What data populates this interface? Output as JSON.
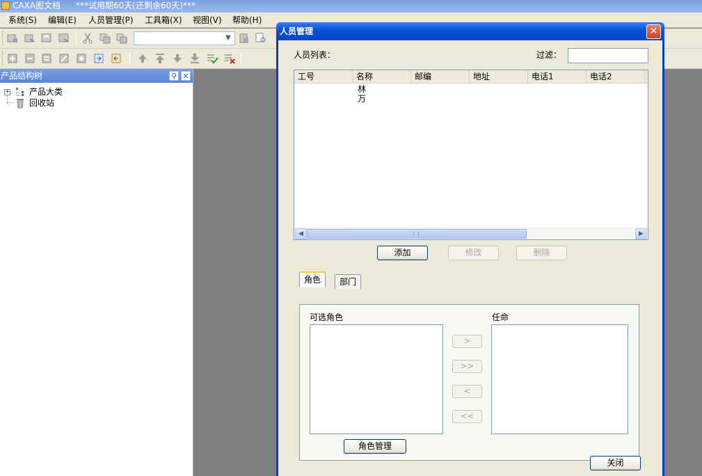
{
  "app": {
    "title": "CAXA图文档",
    "trial_text": "***试用期60天(还剩余60天)***"
  },
  "menubar": {
    "items": [
      "系统(S)",
      "编辑(E)",
      "人员管理(P)",
      "工具箱(X)",
      "视图(V)",
      "帮助(H)"
    ]
  },
  "toolbar": {
    "combo_value": ""
  },
  "tree_panel": {
    "title": "产品结构树",
    "items": [
      {
        "label": "产品大类",
        "icon": "category-icon",
        "expander": "+"
      },
      {
        "label": "回收站",
        "icon": "recycle-bin-icon"
      }
    ]
  },
  "dialog": {
    "title": "人员管理",
    "close_glyph": "✕",
    "person_list_label": "人员列表：",
    "filter_label": "过滤：",
    "filter_value": "",
    "columns": [
      "工号",
      "名称",
      "邮编",
      "地址",
      "电话1",
      "电话2"
    ],
    "rows": [
      {
        "id": "",
        "name": "林",
        "zip": "",
        "address": "",
        "phone1": "",
        "phone2": ""
      },
      {
        "id": "",
        "name": "万",
        "zip": "",
        "address": "",
        "phone1": "",
        "phone2": ""
      }
    ],
    "buttons": {
      "add": "添加",
      "edit": "修改",
      "delete": "删除",
      "role_manage": "角色管理",
      "close": "关闭"
    },
    "tabs": [
      {
        "label": "角色",
        "active": true
      },
      {
        "label": "部门",
        "active": false
      }
    ],
    "available_roles_label": "可选角色",
    "assigned_label": "任命",
    "move_buttons": [
      ">",
      ">>",
      "<",
      "<<"
    ]
  },
  "colors": {
    "dialog_title": "#0a52d8",
    "panel_header": "#6a93df",
    "workspace": "#808080",
    "face": "#ece9d8"
  }
}
